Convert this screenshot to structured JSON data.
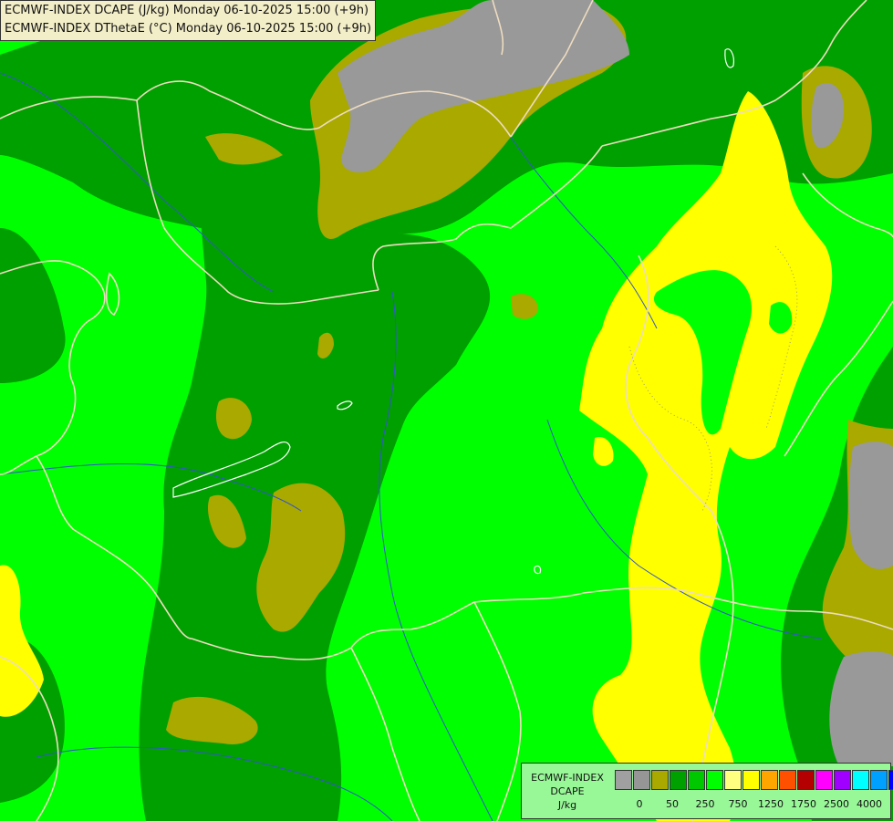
{
  "title": {
    "line1": "ECMWF-INDEX DCAPE (J/kg) Monday 06-10-2025 15:00 (+9h)",
    "line2": "ECMWF-INDEX DThetaE (°C) Monday 06-10-2025 15:00 (+9h)"
  },
  "legend": {
    "model": "ECMWF-INDEX",
    "parameter": "DCAPE",
    "unit": "J/kg",
    "colors": [
      "#a0a0a0",
      "#969696",
      "#a9a900",
      "#00a000",
      "#00c800",
      "#00ff00",
      "#ffff80",
      "#ffff00",
      "#ffa500",
      "#ff5000",
      "#b40000",
      "#ff00ff",
      "#a000ff",
      "#00ffff",
      "#00a0ff",
      "#0000ff",
      "#000080"
    ],
    "ticks": [
      {
        "label": "0",
        "index": 1
      },
      {
        "label": "50",
        "index": 3
      },
      {
        "label": "250",
        "index": 5
      },
      {
        "label": "750",
        "index": 7
      },
      {
        "label": "1250",
        "index": 9
      },
      {
        "label": "1750",
        "index": 11
      },
      {
        "label": "2500",
        "index": 13
      },
      {
        "label": "4000",
        "index": 15
      }
    ]
  },
  "map_colors": {
    "light_green": "#00ff00",
    "dark_green": "#00a000",
    "mid_green": "#00c800",
    "olive": "#a9a900",
    "gray": "#999999",
    "yellow": "#ffff00",
    "border": "#eedcc0",
    "river": "#3355cc",
    "lake": "#ffffff"
  }
}
